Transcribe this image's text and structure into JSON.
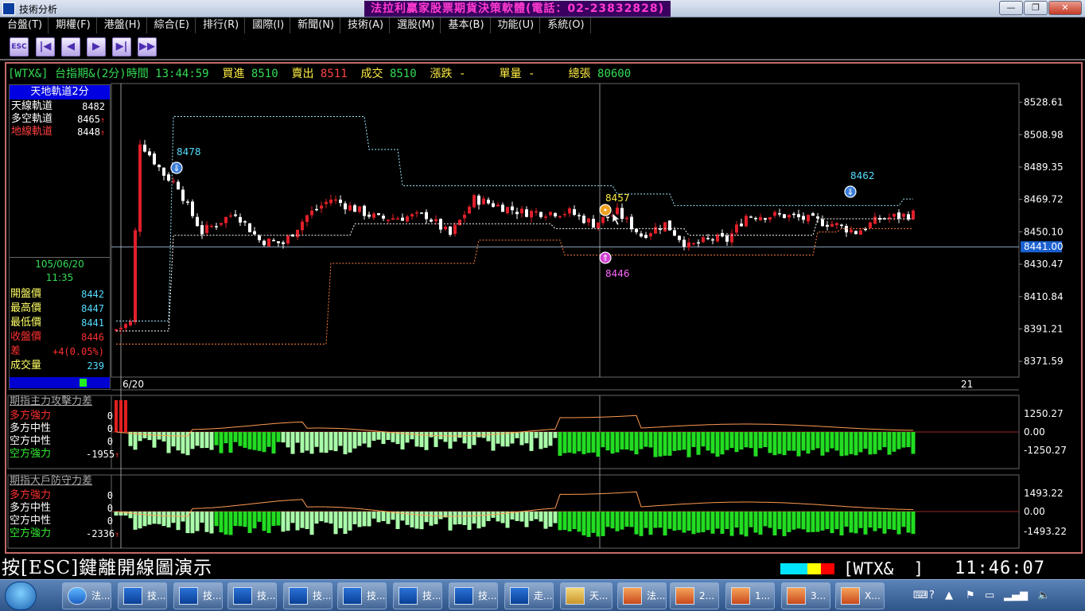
{
  "window": {
    "title": "技術分析",
    "banner": "法拉利贏家股票期貨決策軟體(電話：02-23832828)",
    "buttons": [
      "—",
      "❐",
      "✕"
    ]
  },
  "menu": [
    "台盤(T)",
    "期權(F)",
    "港盤(H)",
    "綜合(E)",
    "排行(R)",
    "國際(I)",
    "新聞(N)",
    "技術(A)",
    "選股(M)",
    "基本(B)",
    "功能(U)",
    "系統(O)"
  ],
  "toolbar": {
    "buttons": [
      {
        "icon": "esc-icon",
        "label": "ESC"
      },
      {
        "icon": "first-page-icon",
        "label": "|◀"
      },
      {
        "icon": "prev-icon",
        "label": "◀"
      },
      {
        "icon": "next-icon",
        "label": "▶"
      },
      {
        "icon": "last-page-icon",
        "label": "▶|"
      },
      {
        "icon": "fast-forward-icon",
        "label": "▶▶"
      }
    ]
  },
  "header": {
    "symbol": "[WTX&]",
    "name": "台指期&(2分)",
    "time_label": "時間",
    "time": "13:44:59",
    "bid_label": "買進",
    "bid": "8510",
    "ask_label": "賣出",
    "ask": "8511",
    "last_label": "成交",
    "last": "8510",
    "change_label": "漲跌",
    "change": "-",
    "vol_label": "單量",
    "vol": "-",
    "total_label": "總張",
    "total": "80600"
  },
  "side": {
    "title": "天地軌道2分",
    "rows": [
      {
        "label": "天線軌道",
        "value": "8482",
        "color": "#ffffff",
        "arrow": ""
      },
      {
        "label": "多空軌道",
        "value": "8465",
        "color": "#ffffff",
        "arrow": "↑"
      },
      {
        "label": "地線軌道",
        "value": "8448",
        "color": "#ff4040",
        "arrow": "↑"
      }
    ],
    "date": "105/06/20",
    "time": "11:35",
    "quotes": [
      {
        "label": "開盤價",
        "value": "8442",
        "color": "#ffff66",
        "vcolor": "#55ddff"
      },
      {
        "label": "最高價",
        "value": "8447",
        "color": "#ffff66",
        "vcolor": "#55ddff"
      },
      {
        "label": "最低價",
        "value": "8441",
        "color": "#ffff66",
        "vcolor": "#55ddff"
      },
      {
        "label": "收盤價",
        "value": "8446",
        "color": "#ff3030",
        "vcolor": "#ff3030"
      },
      {
        "label": "差",
        "value": "+4(0.05%)",
        "color": "#ff3030",
        "vcolor": "#ff3030"
      },
      {
        "label": "成交量",
        "value": "239",
        "color": "#ffff66",
        "vcolor": "#55ddff"
      }
    ]
  },
  "price_axis": {
    "ticks": [
      "8528.61",
      "8508.98",
      "8489.35",
      "8469.72",
      "8450.10",
      "8430.47",
      "8410.84",
      "8391.21",
      "8371.59"
    ],
    "current": "8441.00"
  },
  "x_axis": {
    "left": "6/20",
    "right": "21"
  },
  "annotations": {
    "peak1": "8478",
    "peak2": "8457",
    "peak3": "8462",
    "trough": "8446"
  },
  "indicator1": {
    "title": "期指主力攻擊力差",
    "rows": [
      {
        "label": "多方強力",
        "value": "0",
        "color": "#ff3030",
        "arrow": ""
      },
      {
        "label": "多方中性",
        "value": "0",
        "color": "#ffffff",
        "arrow": ""
      },
      {
        "label": "空方中性",
        "value": "0",
        "color": "#ffffff",
        "arrow": ""
      },
      {
        "label": "空方強力",
        "value": "-1955",
        "color": "#33ee33",
        "arrow": "↑"
      }
    ],
    "ticks": [
      "1250.27",
      "0.00",
      "-1250.27"
    ]
  },
  "indicator2": {
    "title": "期指大戶防守力差",
    "rows": [
      {
        "label": "多方強力",
        "value": "0",
        "color": "#ff3030",
        "arrow": ""
      },
      {
        "label": "多方中性",
        "value": "0",
        "color": "#ffffff",
        "arrow": ""
      },
      {
        "label": "空方中性",
        "value": "0",
        "color": "#ffffff",
        "arrow": ""
      },
      {
        "label": "空方強力",
        "value": "-2336",
        "color": "#33ee33",
        "arrow": "↑"
      }
    ],
    "ticks": [
      "1493.22",
      "0.00",
      "-1493.22"
    ]
  },
  "bottom": {
    "prompt": "按[ESC]鍵離開線圖演示",
    "symbol": "[WTX&  ]",
    "clock": "11:46:07",
    "color_blocks": [
      "#00e5ff",
      "#00e5ff",
      "#ffff00",
      "#ff0000"
    ]
  },
  "taskbar": {
    "items": [
      {
        "icon": "ie-icon",
        "text": "法..."
      },
      {
        "icon": "chart-icon",
        "text": "技..."
      },
      {
        "icon": "chart-icon",
        "text": "技..."
      },
      {
        "icon": "chart-icon",
        "text": "技..."
      },
      {
        "icon": "chart-icon",
        "text": "技..."
      },
      {
        "icon": "chart-icon",
        "text": "技..."
      },
      {
        "icon": "chart-icon",
        "text": "技..."
      },
      {
        "icon": "chart-icon",
        "text": "技..."
      },
      {
        "icon": "chart-icon",
        "text": "走..."
      },
      {
        "icon": "folder-icon",
        "text": "天..."
      },
      {
        "icon": "app-icon",
        "text": "法..."
      },
      {
        "icon": "app-icon",
        "text": "2..."
      },
      {
        "icon": "app-icon",
        "text": "1..."
      },
      {
        "icon": "app-icon",
        "text": "3..."
      },
      {
        "icon": "app-icon",
        "text": "X..."
      }
    ]
  },
  "chart_data": {
    "type": "candlestick",
    "symbol": "WTX&",
    "interval": "2分",
    "ylim": [
      8362,
      8540
    ],
    "current": 8441,
    "highs": [
      8478,
      8457,
      8462
    ],
    "low": 8446
  }
}
